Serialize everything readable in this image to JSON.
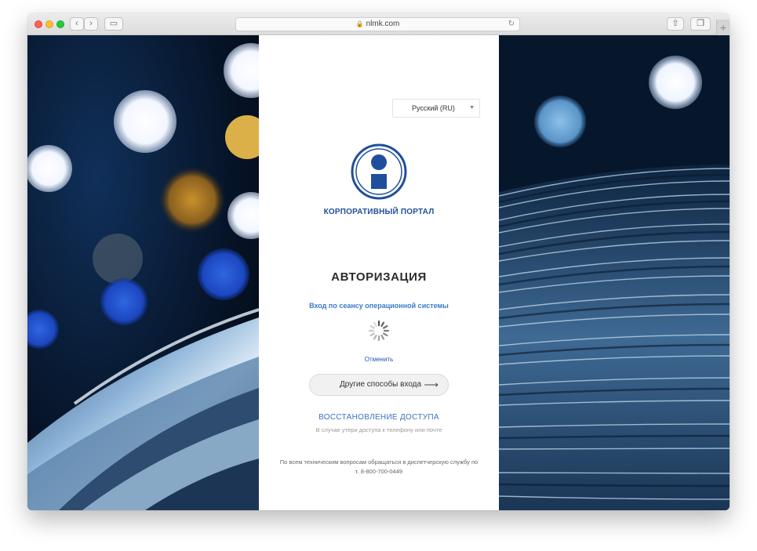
{
  "browser": {
    "url": "nlmk.com",
    "nav_back": "‹",
    "nav_forward": "›",
    "sidebar": "▭",
    "share": "⇧",
    "tabs": "❐",
    "new_tab": "+",
    "reload": "↻"
  },
  "login": {
    "language": "Русский (RU)",
    "portal_title": "КОРПОРАТИВНЫЙ ПОРТАЛ",
    "auth_title": "АВТОРИЗАЦИЯ",
    "sso_text": "Вход по сеансу операционной системы",
    "cancel": "Отменить",
    "other_methods": "Другие способы входа",
    "arrow": "⟶",
    "restore_title": "ВОССТАНОВЛЕНИЕ ДОСТУПА",
    "restore_sub": "В случае утери доступа к телефону или почте",
    "footer": "По всем техническим вопросам обращаться в диспетчерскую службу по т. 8-800-700-0449"
  },
  "colors": {
    "brand": "#1f4f9c",
    "link": "#3a7bc8"
  }
}
